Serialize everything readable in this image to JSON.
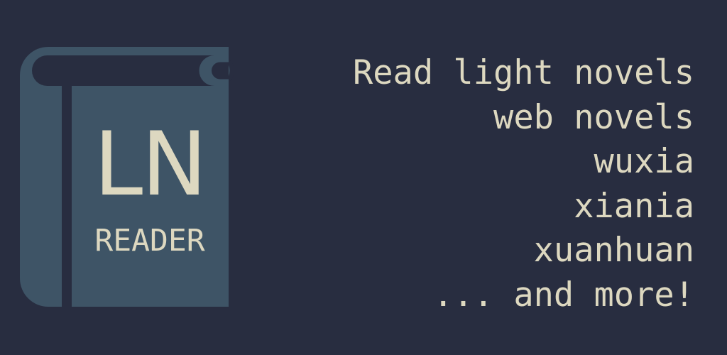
{
  "logo": {
    "title": "LN",
    "subtitle": "READER",
    "icon": "book-icon",
    "colors": {
      "book": "#3e5466",
      "text": "#ddd8c0",
      "background": "#282d40"
    }
  },
  "taglines": [
    "Read light novels",
    "web novels",
    "wuxia",
    "xiania",
    "xuanhuan",
    "... and more!"
  ]
}
